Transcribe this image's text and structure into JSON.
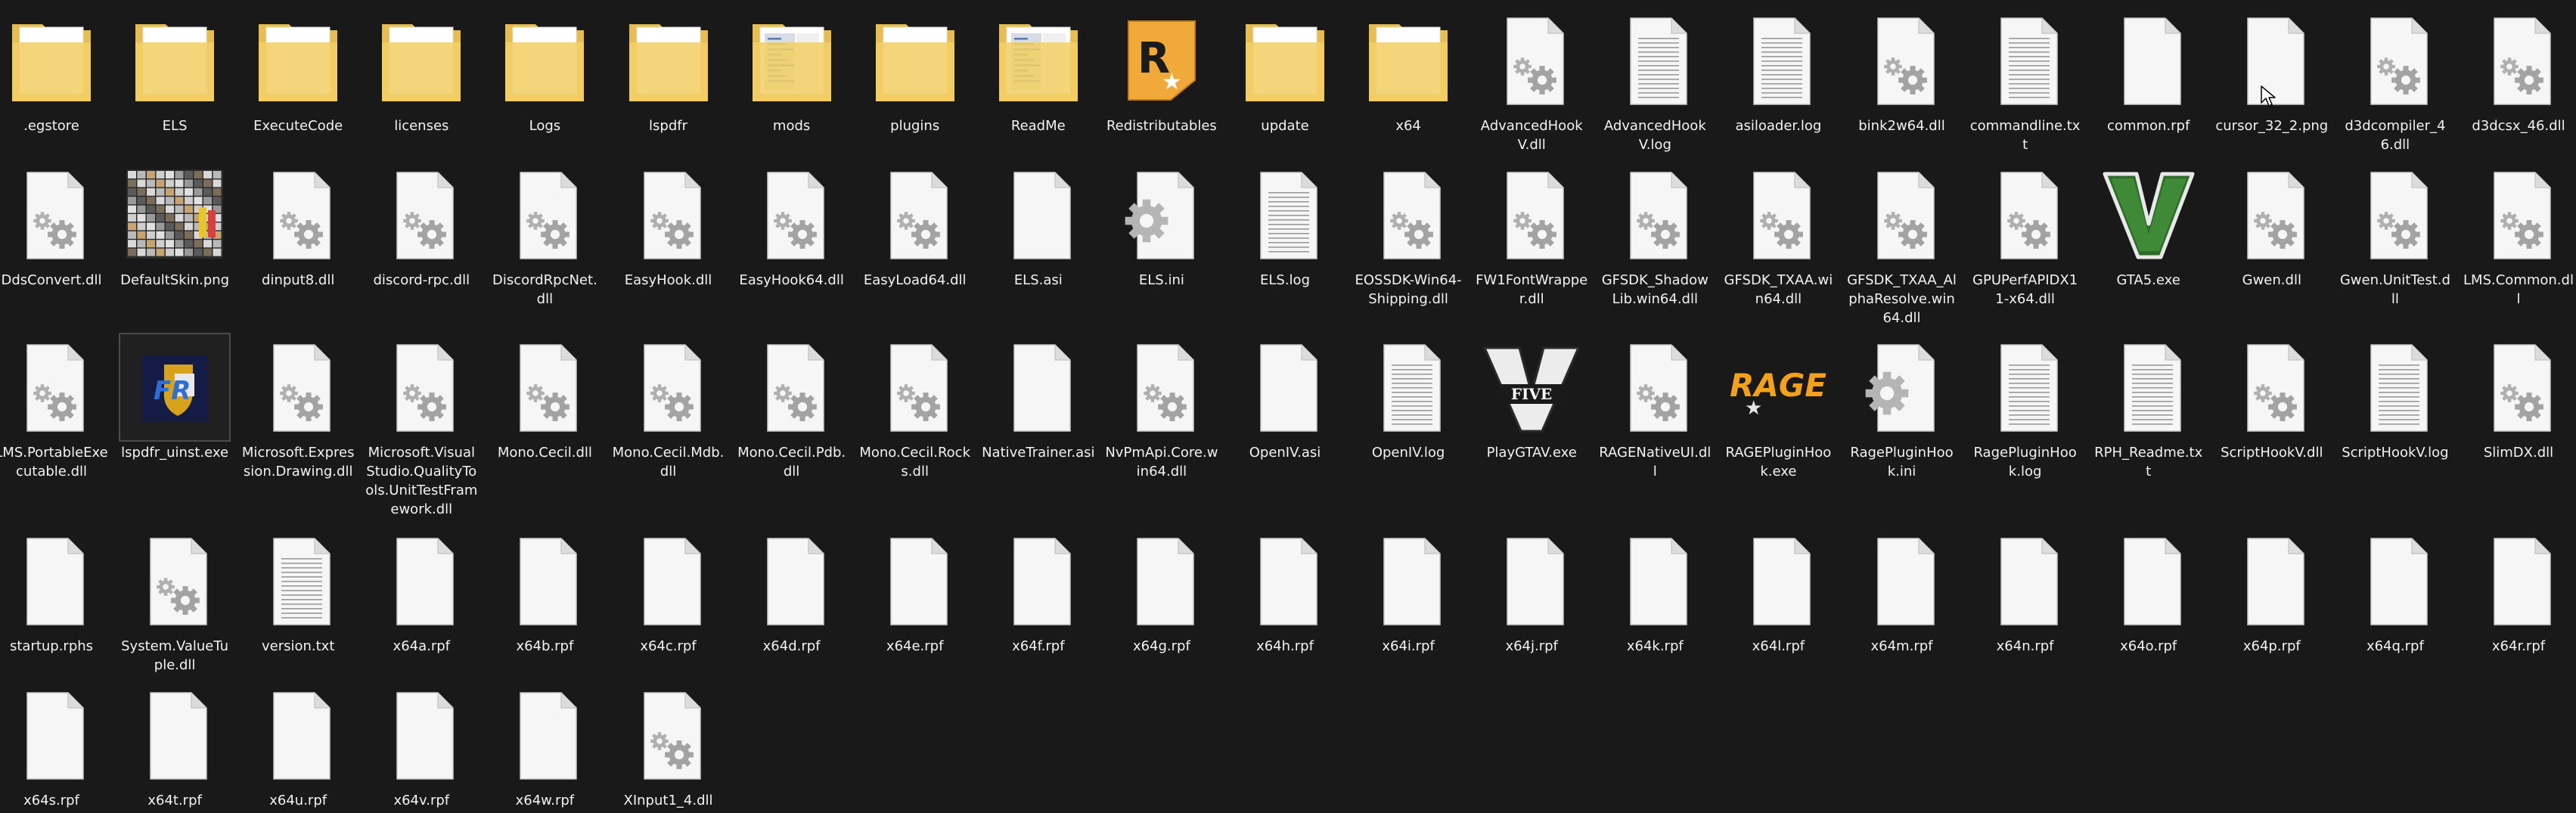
{
  "window": {
    "background": "#191919",
    "text_color": "#f2f2f2"
  },
  "rows": [
    [
      {
        "name": ".egstore",
        "kind": "folder"
      },
      {
        "name": "ELS",
        "kind": "folder"
      },
      {
        "name": "ExecuteCode",
        "kind": "folder"
      },
      {
        "name": "licenses",
        "kind": "folder"
      },
      {
        "name": "Logs",
        "kind": "folder"
      },
      {
        "name": "lspdfr",
        "kind": "folder"
      },
      {
        "name": "mods",
        "kind": "folder-docs"
      },
      {
        "name": "plugins",
        "kind": "folder"
      },
      {
        "name": "ReadMe",
        "kind": "folder-docs"
      },
      {
        "name": "Redistributables",
        "kind": "rockstar-icon"
      },
      {
        "name": "update",
        "kind": "folder"
      },
      {
        "name": "x64",
        "kind": "folder"
      },
      {
        "name": "AdvancedHookV.dll",
        "kind": "dll"
      },
      {
        "name": "AdvancedHookV.log",
        "kind": "text"
      },
      {
        "name": "asiloader.log",
        "kind": "text"
      },
      {
        "name": "bink2w64.dll",
        "kind": "dll"
      },
      {
        "name": "commandline.txt",
        "kind": "text"
      },
      {
        "name": "common.rpf",
        "kind": "blank"
      },
      {
        "name": "cursor_32_2.png",
        "kind": "blank"
      },
      {
        "name": "d3dcompiler_46.dll",
        "kind": "dll"
      },
      {
        "name": "d3dcsx_46.dll",
        "kind": "dll"
      }
    ],
    [
      {
        "name": "DdsConvert.dll",
        "kind": "dll"
      },
      {
        "name": "DefaultSkin.png",
        "kind": "skin-image"
      },
      {
        "name": "dinput8.dll",
        "kind": "dll"
      },
      {
        "name": "discord-rpc.dll",
        "kind": "dll"
      },
      {
        "name": "DiscordRpcNet.dll",
        "kind": "dll"
      },
      {
        "name": "EasyHook.dll",
        "kind": "dll"
      },
      {
        "name": "EasyHook64.dll",
        "kind": "dll"
      },
      {
        "name": "EasyLoad64.dll",
        "kind": "dll"
      },
      {
        "name": "ELS.asi",
        "kind": "blank"
      },
      {
        "name": "ELS.ini",
        "kind": "ini"
      },
      {
        "name": "ELS.log",
        "kind": "text"
      },
      {
        "name": "EOSSDK-Win64-Shipping.dll",
        "kind": "dll"
      },
      {
        "name": "FW1FontWrapper.dll",
        "kind": "dll"
      },
      {
        "name": "GFSDK_ShadowLib.win64.dll",
        "kind": "dll"
      },
      {
        "name": "GFSDK_TXAA.win64.dll",
        "kind": "dll"
      },
      {
        "name": "GFSDK_TXAA_AlphaResolve.win64.dll",
        "kind": "dll"
      },
      {
        "name": "GPUPerfAPIDX11-x64.dll",
        "kind": "dll"
      },
      {
        "name": "GTA5.exe",
        "kind": "gta-v-icon"
      },
      {
        "name": "Gwen.dll",
        "kind": "dll"
      },
      {
        "name": "Gwen.UnitTest.dll",
        "kind": "dll"
      },
      {
        "name": "LMS.Common.dll",
        "kind": "dll"
      }
    ],
    [
      {
        "name": "LMS.PortableExecutable.dll",
        "kind": "dll"
      },
      {
        "name": "lspdfr_uinst.exe",
        "kind": "lspdfr-icon",
        "selected": true
      },
      {
        "name": "Microsoft.Expression.Drawing.dll",
        "kind": "dll"
      },
      {
        "name": "Microsoft.VisualStudio.QualityTools.UnitTestFramework.dll",
        "kind": "dll"
      },
      {
        "name": "Mono.Cecil.dll",
        "kind": "dll"
      },
      {
        "name": "Mono.Cecil.Mdb.dll",
        "kind": "dll"
      },
      {
        "name": "Mono.Cecil.Pdb.dll",
        "kind": "dll"
      },
      {
        "name": "Mono.Cecil.Rocks.dll",
        "kind": "dll"
      },
      {
        "name": "NativeTrainer.asi",
        "kind": "blank"
      },
      {
        "name": "NvPmApi.Core.win64.dll",
        "kind": "dll"
      },
      {
        "name": "OpenIV.asi",
        "kind": "blank"
      },
      {
        "name": "OpenIV.log",
        "kind": "text"
      },
      {
        "name": "PlayGTAV.exe",
        "kind": "five-icon"
      },
      {
        "name": "RAGENativeUI.dll",
        "kind": "dll"
      },
      {
        "name": "RAGEPluginHook.exe",
        "kind": "rage-icon"
      },
      {
        "name": "RagePluginHook.ini",
        "kind": "ini"
      },
      {
        "name": "RagePluginHook.log",
        "kind": "text"
      },
      {
        "name": "RPH_Readme.txt",
        "kind": "text"
      },
      {
        "name": "ScriptHookV.dll",
        "kind": "dll"
      },
      {
        "name": "ScriptHookV.log",
        "kind": "text"
      },
      {
        "name": "SlimDX.dll",
        "kind": "dll"
      }
    ],
    [
      {
        "name": "startup.rphs",
        "kind": "blank"
      },
      {
        "name": "System.ValueTuple.dll",
        "kind": "dll"
      },
      {
        "name": "version.txt",
        "kind": "text"
      },
      {
        "name": "x64a.rpf",
        "kind": "blank"
      },
      {
        "name": "x64b.rpf",
        "kind": "blank"
      },
      {
        "name": "x64c.rpf",
        "kind": "blank"
      },
      {
        "name": "x64d.rpf",
        "kind": "blank"
      },
      {
        "name": "x64e.rpf",
        "kind": "blank"
      },
      {
        "name": "x64f.rpf",
        "kind": "blank"
      },
      {
        "name": "x64g.rpf",
        "kind": "blank"
      },
      {
        "name": "x64h.rpf",
        "kind": "blank"
      },
      {
        "name": "x64i.rpf",
        "kind": "blank"
      },
      {
        "name": "x64j.rpf",
        "kind": "blank"
      },
      {
        "name": "x64k.rpf",
        "kind": "blank"
      },
      {
        "name": "x64l.rpf",
        "kind": "blank"
      },
      {
        "name": "x64m.rpf",
        "kind": "blank"
      },
      {
        "name": "x64n.rpf",
        "kind": "blank"
      },
      {
        "name": "x64o.rpf",
        "kind": "blank"
      },
      {
        "name": "x64p.rpf",
        "kind": "blank"
      },
      {
        "name": "x64q.rpf",
        "kind": "blank"
      },
      {
        "name": "x64r.rpf",
        "kind": "blank"
      }
    ],
    [
      {
        "name": "x64s.rpf",
        "kind": "blank"
      },
      {
        "name": "x64t.rpf",
        "kind": "blank"
      },
      {
        "name": "x64u.rpf",
        "kind": "blank"
      },
      {
        "name": "x64v.rpf",
        "kind": "blank"
      },
      {
        "name": "x64w.rpf",
        "kind": "blank"
      },
      {
        "name": "XInput1_4.dll",
        "kind": "dll"
      }
    ]
  ],
  "cursor": {
    "icon": "mouse-pointer-icon"
  }
}
